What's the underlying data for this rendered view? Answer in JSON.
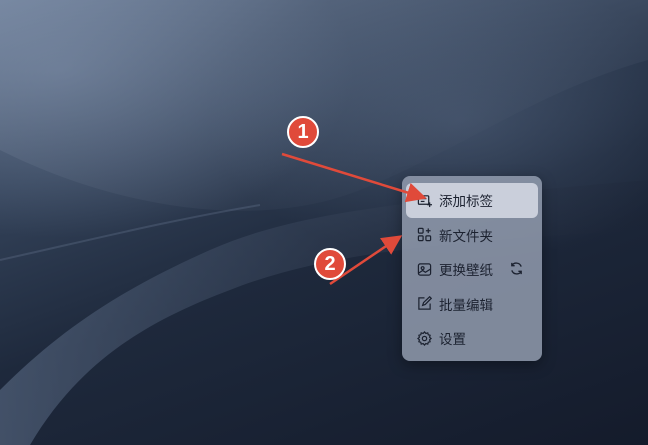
{
  "menu": {
    "items": [
      {
        "label": "添加标签",
        "icon": "tag-add-icon",
        "highlighted": true
      },
      {
        "label": "新文件夹",
        "icon": "folder-add-icon"
      },
      {
        "label": "更换壁纸",
        "icon": "wallpaper-icon",
        "extra_icon": "refresh-icon"
      },
      {
        "label": "批量编辑",
        "icon": "edit-icon"
      },
      {
        "label": "设置",
        "icon": "gear-icon"
      }
    ]
  },
  "annotations": {
    "step1": "1",
    "step2": "2",
    "color": "#e04a3a"
  }
}
